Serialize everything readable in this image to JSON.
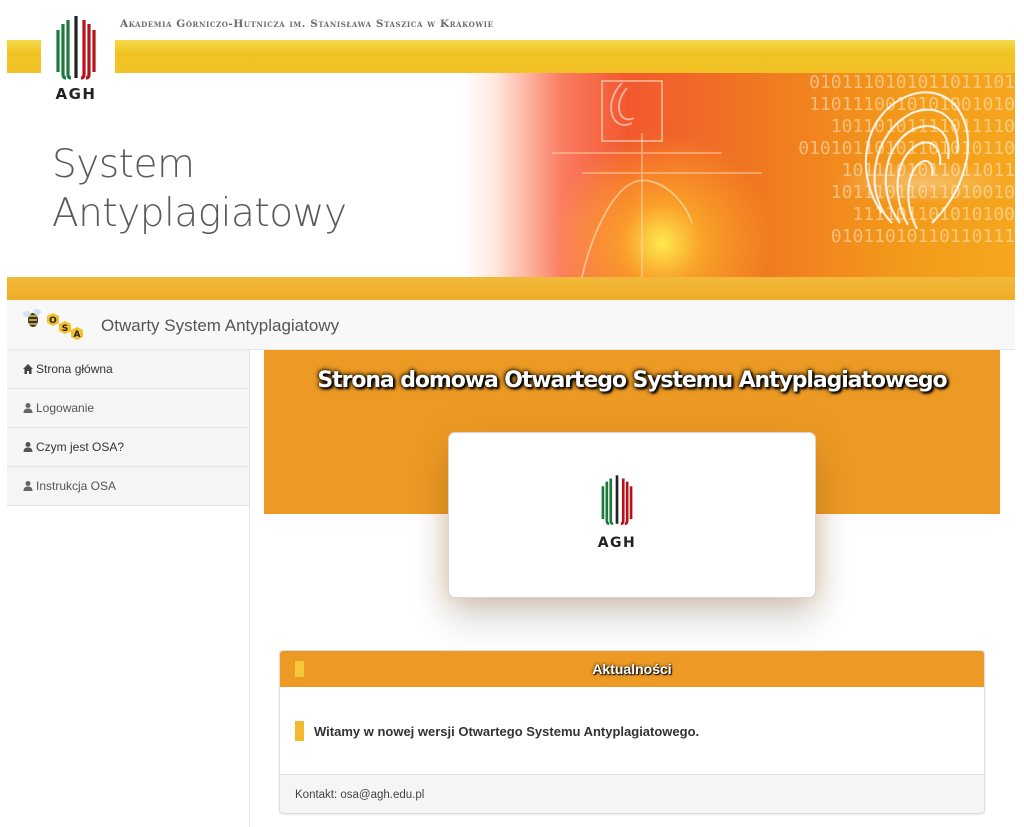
{
  "header": {
    "university_name": "Akademia Górniczo-Hutnicza im. Stanisława Staszica w Krakowie",
    "logo_text": "AGH",
    "title_line1": "System",
    "title_line2": "Antyplagiatowy",
    "binary_rows": [
      "0101110101011011101",
      "1101110010101001010",
      "10110101111011110",
      "01010110101101010110",
      "1011101011011011",
      "10111011011010010",
      "111101101010100",
      "01011010110110111"
    ]
  },
  "navbar": {
    "brand": "Otwarty System Antyplagiatowy",
    "logo_letters": [
      "O",
      "S",
      "A"
    ]
  },
  "sidebar": {
    "items": [
      {
        "label": "Strona główna",
        "icon": "home-icon"
      },
      {
        "label": "Logowanie",
        "icon": "user-icon"
      },
      {
        "label": "Czym jest OSA?",
        "icon": "user-icon"
      },
      {
        "label": "Instrukcja OSA",
        "icon": "user-icon"
      }
    ]
  },
  "main": {
    "jumbotron_title": "Strona domowa Otwartego Systemu Antyplagiatowego",
    "card_logo_text": "AGH",
    "news": {
      "title": "Aktualności",
      "message": "Witamy w nowej wersji Otwartego Systemu Antyplagiatowego.",
      "contact": "Kontakt: osa@agh.edu.pl"
    }
  },
  "colors": {
    "brand_orange": "#ec9a24",
    "agh_green": "#1e7a3c",
    "agh_red": "#b5121b",
    "agh_black": "#222222",
    "stripe_yellow": "#f0c322"
  }
}
